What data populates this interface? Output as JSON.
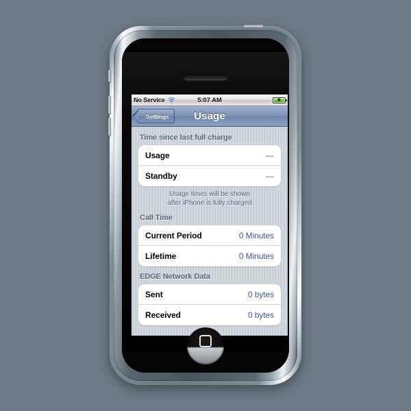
{
  "device": {
    "name": "iPhone",
    "home_button": "home-button",
    "earpiece": "earpiece-speaker"
  },
  "status_bar": {
    "carrier": "No Service",
    "wifi_icon": "wifi-icon",
    "time": "5:07 AM",
    "battery_icon": "battery-charging-icon",
    "battery_level_percent": 88,
    "charging": true
  },
  "nav_bar": {
    "back_label": "Settings",
    "title": "Usage"
  },
  "sections": [
    {
      "header": "Time since last full charge",
      "rows": [
        {
          "label": "Usage",
          "value": "—"
        },
        {
          "label": "Standby",
          "value": "—"
        }
      ],
      "footer_line1": "Usage times will be shown",
      "footer_line2": "after iPhone is fully charged"
    },
    {
      "header": "Call Time",
      "rows": [
        {
          "label": "Current Period",
          "value": "0 Minutes"
        },
        {
          "label": "Lifetime",
          "value": "0 Minutes"
        }
      ]
    },
    {
      "header": "EDGE Network Data",
      "rows": [
        {
          "label": "Sent",
          "value": "0 bytes"
        },
        {
          "label": "Received",
          "value": "0 bytes"
        }
      ]
    }
  ],
  "colors": {
    "page_background": "#6d7a84",
    "nav_bar_blue": "#7d94b6",
    "table_background": "#c9d0d8",
    "value_text": "#3b5a92",
    "header_text": "#5d6b7e",
    "battery_green": "#6fcc21"
  }
}
